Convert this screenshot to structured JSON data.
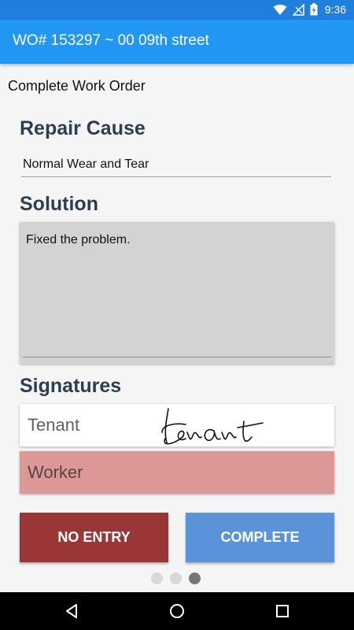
{
  "status_bar": {
    "time": "9:36",
    "color": "#1e80dc",
    "icons": [
      "wifi-icon",
      "no-signal-icon",
      "battery-charging-icon"
    ]
  },
  "app_bar": {
    "title": "WO# 153297 ~ 00 09th street",
    "color": "#2196f3"
  },
  "page": {
    "subtitle": "Complete Work Order"
  },
  "repair_cause": {
    "heading": "Repair Cause",
    "value": "Normal Wear and Tear"
  },
  "solution": {
    "heading": "Solution",
    "value": "Fixed the problem."
  },
  "signatures": {
    "heading": "Signatures",
    "tenant_label": "Tenant",
    "tenant_signature_text": "Tenant",
    "tenant_signed": true,
    "worker_label": "Worker",
    "worker_signed": false,
    "worker_color": "#dc9896"
  },
  "actions": {
    "no_entry_label": "NO ENTRY",
    "no_entry_color": "#9b3636",
    "complete_label": "COMPLETE",
    "complete_color": "#5a93d7"
  },
  "pager": {
    "pages": 3,
    "current_page": 3
  },
  "nav_bar": {
    "icons": [
      "back-icon",
      "home-icon",
      "recents-icon"
    ]
  }
}
